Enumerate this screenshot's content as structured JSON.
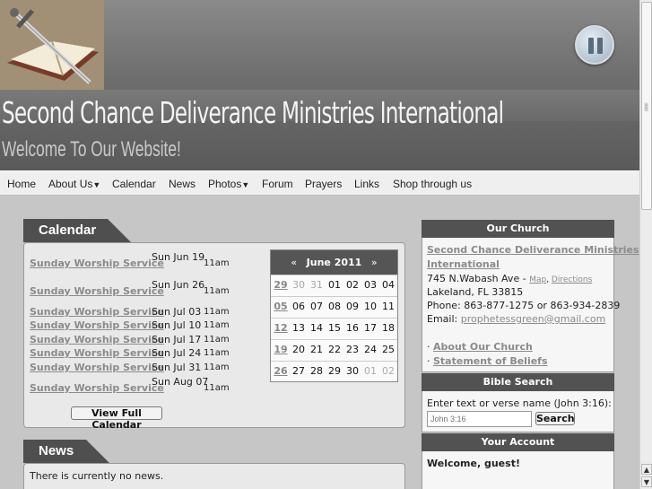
{
  "site": {
    "title": "Second Chance Deliverance Ministries International",
    "subtitle": "Welcome To Our Website!"
  },
  "nav": {
    "items": [
      {
        "label": "Home"
      },
      {
        "label": "About Us"
      },
      {
        "label": "Calendar"
      },
      {
        "label": "News"
      },
      {
        "label": "Photos"
      },
      {
        "label": "Forum"
      },
      {
        "label": "Prayers"
      },
      {
        "label": "Links"
      },
      {
        "label": "Shop through us"
      }
    ]
  },
  "calendar": {
    "title": "Calendar",
    "events": [
      {
        "name": "Sunday Worship Service",
        "date": "Sun Jun 19",
        "time": "11am"
      },
      {
        "name": "Sunday Worship Service",
        "date": "Sun Jun 26",
        "time": "11am"
      },
      {
        "name": "Sunday Worship Service",
        "date": "Sun Jul 03",
        "time": "11am"
      },
      {
        "name": "Sunday Worship Service",
        "date": "Sun Jul 10",
        "time": "11am"
      },
      {
        "name": "Sunday Worship Service",
        "date": "Sun Jul 17",
        "time": "11am"
      },
      {
        "name": "Sunday Worship Service",
        "date": "Sun Jul 24",
        "time": "11am"
      },
      {
        "name": "Sunday Worship Service",
        "date": "Sun Jul 31",
        "time": "11am"
      },
      {
        "name": "Sunday Worship Service",
        "date": "Sun Aug 07",
        "time": "11am"
      }
    ],
    "full_button": "View Full Calendar",
    "mini": {
      "prev": "«",
      "next": "»",
      "month": "June 2011",
      "weeks": [
        [
          "29",
          "30",
          "31",
          "01",
          "02",
          "03",
          "04"
        ],
        [
          "05",
          "06",
          "07",
          "08",
          "09",
          "10",
          "11"
        ],
        [
          "12",
          "13",
          "14",
          "15",
          "16",
          "17",
          "18"
        ],
        [
          "19",
          "20",
          "21",
          "22",
          "23",
          "24",
          "25"
        ],
        [
          "26",
          "27",
          "28",
          "29",
          "30",
          "01",
          "02"
        ]
      ]
    }
  },
  "news": {
    "title": "News",
    "empty_text": "There is currently no news."
  },
  "church": {
    "title": "Our Church",
    "name_line1": "Second Chance Deliverance Ministries",
    "name_line2": "International",
    "address": "745 N.Wabash Ave - ",
    "map_link": "Map",
    "sep": ", ",
    "directions_link": "Directions",
    "city": "Lakeland, FL 33815",
    "phone": "Phone: 863-877-1275 or 863-934-2839",
    "email_label": "Email: ",
    "email": "prophetessgreen@gmail.com",
    "links": [
      {
        "bullet": "· ",
        "label": "About Our Church"
      },
      {
        "bullet": "· ",
        "label": "Statement of Beliefs"
      }
    ]
  },
  "bible_search": {
    "title": "Bible Search",
    "prompt": "Enter text or verse name (John 3:16):",
    "placeholder": "John 3:16",
    "button": "Search"
  },
  "account": {
    "title": "Your Account",
    "welcome": "Welcome, guest!"
  },
  "player": {
    "control": "pause"
  }
}
